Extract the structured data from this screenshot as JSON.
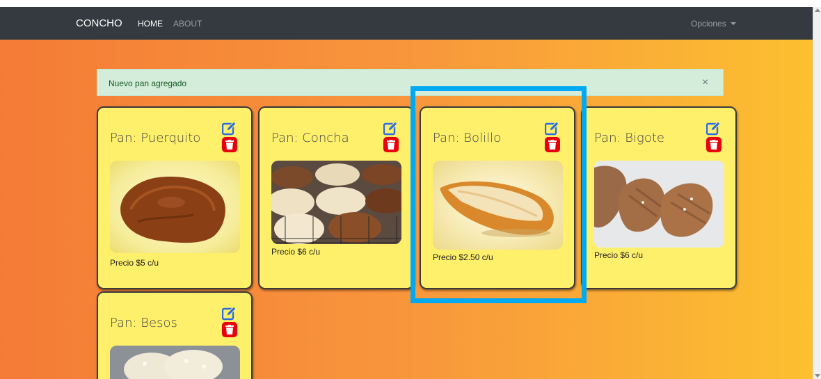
{
  "navbar": {
    "brand": "CONCHO",
    "links": [
      {
        "label": "HOME"
      },
      {
        "label": "ABOUT"
      }
    ],
    "dropdown": {
      "label": "Opciones"
    }
  },
  "alert": {
    "message": "Nuevo pan agregado",
    "close": "×"
  },
  "cards": [
    {
      "title": "Pan: Puerquito",
      "price": "Precio $5 c/u"
    },
    {
      "title": "Pan: Concha",
      "price": "Precio $6 c/u"
    },
    {
      "title": "Pan: Bolillo",
      "price": "Precio $2.50 c/u"
    },
    {
      "title": "Pan: Bigote",
      "price": "Precio $6 c/u"
    },
    {
      "title": "Pan: Besos",
      "price": ""
    }
  ],
  "colors": {
    "navbar": "#343a40",
    "card": "#fff06b",
    "edit_icon": "#2a6be3",
    "delete_button": "#e8000b",
    "highlight": "#00a9f1",
    "alert_bg": "#d4edda"
  },
  "icons": {
    "edit": "pen-square-icon",
    "delete": "trash-icon"
  }
}
